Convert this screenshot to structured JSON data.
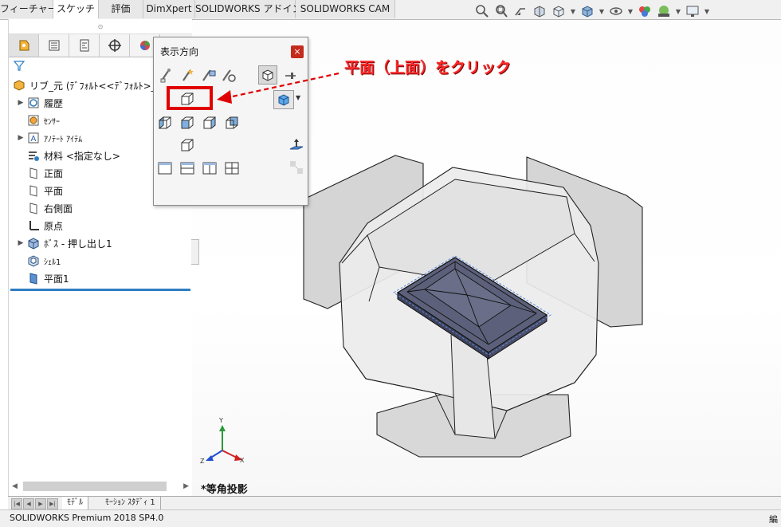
{
  "tabs": [
    {
      "label": "フィーチャー",
      "active": false
    },
    {
      "label": "スケッチ",
      "active": true
    },
    {
      "label": "評価",
      "active": false
    },
    {
      "label": "DimXpert",
      "active": false
    },
    {
      "label": "SOLIDWORKS アドイン",
      "active": false
    },
    {
      "label": "SOLIDWORKS CAM",
      "active": false
    }
  ],
  "hud_icons": [
    "zoom-to-fit-icon",
    "zoom-area-icon",
    "previous-view-icon",
    "section-view-icon",
    "view-orientation-icon",
    "display-style-icon",
    "hide-show-icon",
    "appearance-icon",
    "scene-icon",
    "view-settings-icon"
  ],
  "panel": {
    "tabs": [
      "feature-manager-icon",
      "property-manager-icon",
      "configuration-manager-icon",
      "dimxpert-icon",
      "display-manager-icon"
    ],
    "tree": [
      {
        "label": "リブ_元 (ﾃﾞﾌｫﾙﾄ<<ﾃﾞﾌｫﾙﾄ>_表",
        "icon": "part-icon",
        "expand": false,
        "indent": 0,
        "small": false
      },
      {
        "label": "履歴",
        "icon": "history-icon",
        "expand": true,
        "indent": 1,
        "small": false
      },
      {
        "label": "ｾﾝｻｰ",
        "icon": "sensor-icon",
        "expand": false,
        "indent": 1,
        "small": true
      },
      {
        "label": "ｱﾉﾃｰﾄ ｱｲﾃﾑ",
        "icon": "annotations-icon",
        "expand": true,
        "indent": 1,
        "small": true
      },
      {
        "label": "材料 <指定なし>",
        "icon": "material-icon",
        "expand": false,
        "indent": 1,
        "small": false
      },
      {
        "label": "正面",
        "icon": "plane-icon",
        "expand": false,
        "indent": 1,
        "small": false
      },
      {
        "label": "平面",
        "icon": "plane-icon",
        "expand": false,
        "indent": 1,
        "small": false
      },
      {
        "label": "右側面",
        "icon": "plane-icon",
        "expand": false,
        "indent": 1,
        "small": false
      },
      {
        "label": "原点",
        "icon": "origin-icon",
        "expand": false,
        "indent": 1,
        "small": false
      },
      {
        "label": "ﾎﾞｽ - 押し出し1",
        "icon": "boss-extrude-icon",
        "expand": true,
        "indent": 1,
        "small": false
      },
      {
        "label": "ｼｪﾙ1",
        "icon": "shell-icon",
        "expand": false,
        "indent": 1,
        "small": true
      },
      {
        "label": "平面1",
        "icon": "plane1-icon",
        "expand": false,
        "indent": 1,
        "small": false
      }
    ]
  },
  "orientation_popup": {
    "title": "表示方向",
    "close": "×"
  },
  "annotation": "平面（上面）をクリック",
  "view_name": "*等角投影",
  "bottom_tabs": [
    {
      "label": "ﾓﾃﾞﾙ",
      "active": true
    },
    {
      "label": "ﾓｰｼｮﾝ ｽﾀﾃﾞｨ 1",
      "active": false
    }
  ],
  "status": "SOLIDWORKS Premium 2018 SP4.0",
  "status_right": "編",
  "colors": {
    "accent": "#2f7ec2",
    "highlight": "#e00000",
    "annotation": "#ff2a2a",
    "body": "#595d78"
  }
}
